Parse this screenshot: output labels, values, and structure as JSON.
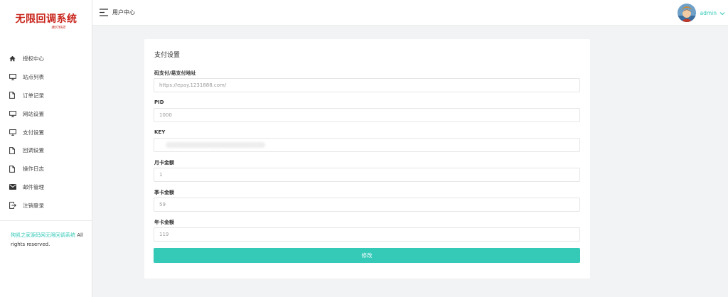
{
  "brand": {
    "title": "无限回调系统",
    "subtitle": "我们科技"
  },
  "sidebar": {
    "items": [
      {
        "label": "授权中心",
        "icon": "home-icon"
      },
      {
        "label": "站点列表",
        "icon": "monitor-icon"
      },
      {
        "label": "订单记录",
        "icon": "document-icon"
      },
      {
        "label": "网站设置",
        "icon": "monitor-icon"
      },
      {
        "label": "支付设置",
        "icon": "monitor-icon"
      },
      {
        "label": "回调设置",
        "icon": "document-icon"
      },
      {
        "label": "操作日志",
        "icon": "document-icon"
      },
      {
        "label": "邮件管理",
        "icon": "mail-icon"
      },
      {
        "label": "注销登录",
        "icon": "logout-icon"
      }
    ],
    "footer": {
      "link_text": "狗凯之家源码网无限回调系统",
      "suffix": " All rights reserved."
    }
  },
  "header": {
    "breadcrumb": "用户中心",
    "username": "admin"
  },
  "form": {
    "title": "支付设置",
    "fields": [
      {
        "label": "码支付/易支付地址",
        "placeholder": "https://epay.1231888.com/",
        "value": ""
      },
      {
        "label": "PID",
        "placeholder": "1000",
        "value": ""
      },
      {
        "label": "KEY",
        "placeholder": "",
        "value": ""
      },
      {
        "label": "月卡金额",
        "placeholder": "1",
        "value": ""
      },
      {
        "label": "季卡金额",
        "placeholder": "59",
        "value": ""
      },
      {
        "label": "年卡金额",
        "placeholder": "119",
        "value": ""
      }
    ],
    "submit_label": "修改"
  },
  "colors": {
    "accent": "#35c9b8",
    "brand": "#c8251c",
    "background": "#f2f3f5"
  }
}
